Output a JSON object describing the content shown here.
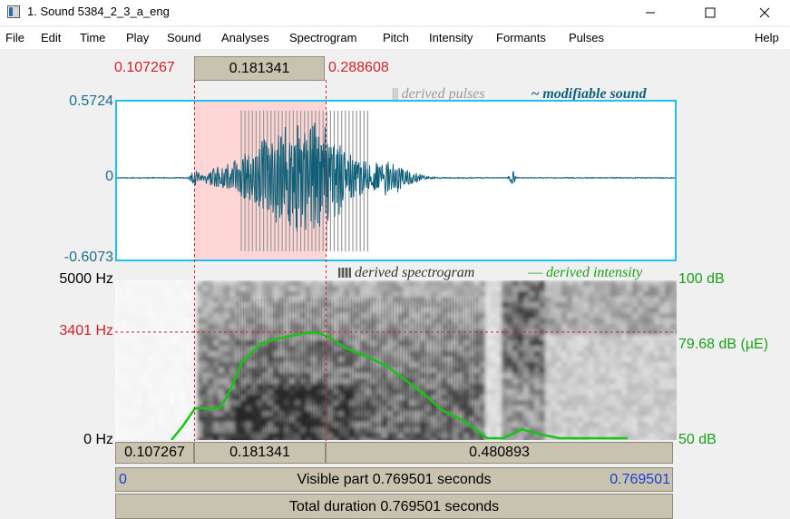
{
  "window": {
    "title": "1. Sound 5384_2_3_a_eng",
    "controls": [
      "minimize",
      "maximize",
      "close"
    ]
  },
  "menu": [
    "File",
    "Edit",
    "Time",
    "Play",
    "Sound",
    "Analyses",
    "Spectrogram",
    "Pitch",
    "Intensity",
    "Formants",
    "Pulses"
  ],
  "menu_right": "Help",
  "selection": {
    "start": "0.107267",
    "length": "0.181341",
    "end": "0.288608"
  },
  "waveform": {
    "ymax": "0.5724",
    "yzero": "0",
    "ymin": "-0.6073",
    "legend_pulses": "derived pulses",
    "legend_sound": "modifiable sound"
  },
  "spectrogram": {
    "top": "5000 Hz",
    "cursor": "3401 Hz",
    "bottom": "0 Hz",
    "intensity_top": "100 dB",
    "intensity_cursor": "79.68 dB (µE)",
    "intensity_bottom": "50 dB",
    "legend_spectrogram": "derived spectrogram",
    "legend_intensity": "derived intensity"
  },
  "time_bar": {
    "left": "0.107267",
    "selection": "0.181341",
    "right": "0.480893"
  },
  "visible_bar": {
    "start": "0",
    "label": "Visible part 0.769501 seconds",
    "end": "0.769501"
  },
  "total_bar": {
    "label": "Total duration 0.769501 seconds"
  },
  "colors": {
    "waveform": "#0e5f78",
    "selection_fill": "#ffd6d6",
    "cursor": "#d0202a",
    "intensity": "#15c515",
    "frame": "#1ec0f0",
    "pulses": "#9a9a9a",
    "button": "#c8c3af"
  }
}
